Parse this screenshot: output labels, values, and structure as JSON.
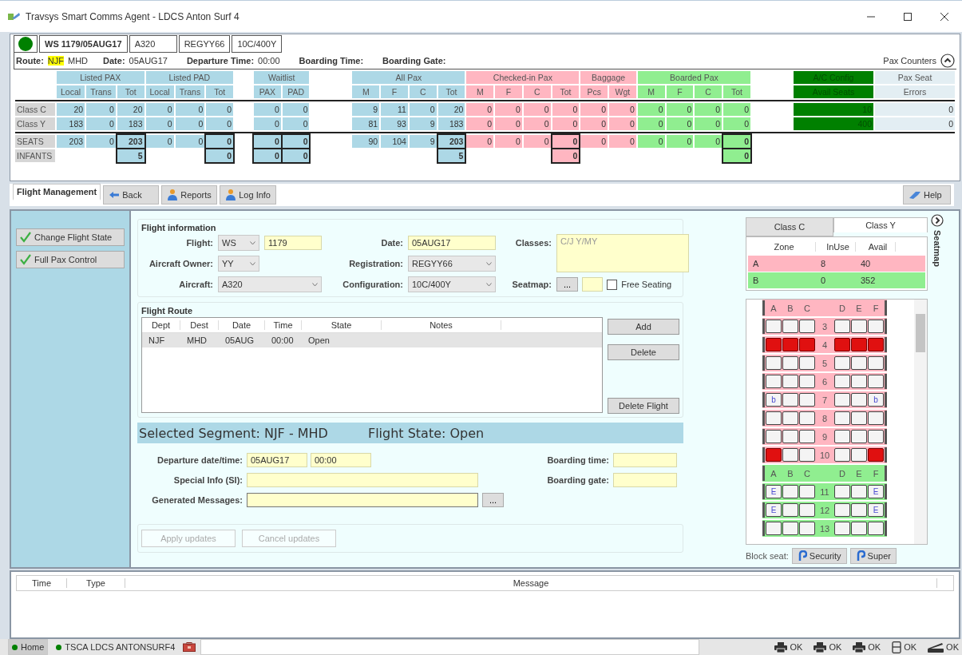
{
  "window": {
    "title": "Travsys Smart Comms Agent - LDCS Anton Surf 4"
  },
  "flight_header": {
    "connected": true,
    "flight": "WS 1179/05AUG17",
    "aircraft": "A320",
    "registration": "REGYY66",
    "configuration": "10C/400Y"
  },
  "route_line": {
    "route_label": "Route:",
    "origin": "NJF",
    "origin_highlighted": true,
    "destination": "MHD",
    "items": [
      {
        "label": "Date:",
        "value": "05AUG17"
      },
      {
        "label": "Departure Time:",
        "value": "00:00"
      },
      {
        "label": "Boarding Time:"
      },
      {
        "label": "Boarding Gate:"
      }
    ]
  },
  "pax_counters": {
    "title": "Pax Counters",
    "expanded": true,
    "groups": [
      {
        "label": "Listed PAX",
        "kind": "blue",
        "columns": [
          {
            "label": "Local",
            "total": false
          },
          {
            "label": "Trans",
            "total": false
          },
          {
            "label": "Tot",
            "total": true
          }
        ]
      },
      {
        "label": "Listed PAD",
        "kind": "blue",
        "columns": [
          {
            "label": "Local",
            "total": false
          },
          {
            "label": "Trans",
            "total": false
          },
          {
            "label": "Tot",
            "total": true
          }
        ]
      },
      {
        "label": "Waitlist",
        "kind": "blue",
        "columns": [
          {
            "label": "PAX",
            "total": true
          },
          {
            "label": "PAD",
            "total": true
          }
        ]
      },
      {
        "label": "All Pax",
        "kind": "blue",
        "columns": [
          {
            "label": "M",
            "total": false
          },
          {
            "label": "F",
            "total": false
          },
          {
            "label": "C",
            "total": false
          },
          {
            "label": "Tot",
            "total": true
          }
        ]
      },
      {
        "label": "Checked-in Pax",
        "kind": "pink",
        "columns": [
          {
            "label": "M",
            "total": false
          },
          {
            "label": "F",
            "total": false
          },
          {
            "label": "C",
            "total": false
          },
          {
            "label": "Tot",
            "total": true
          }
        ]
      },
      {
        "label": "Baggage",
        "kind": "pink",
        "columns": [
          {
            "label": "Pcs",
            "total": false
          },
          {
            "label": "Wgt",
            "total": false
          }
        ]
      },
      {
        "label": "Boarded Pax",
        "kind": "green",
        "columns": [
          {
            "label": "M",
            "total": false
          },
          {
            "label": "F",
            "total": false
          },
          {
            "label": "C",
            "total": false
          },
          {
            "label": "Tot",
            "total": true
          }
        ]
      },
      {
        "label": "A/C Config",
        "kind": "darkgreen",
        "columns": [
          {
            "label": "Avail Seats"
          }
        ]
      },
      {
        "label": "Pax Seat",
        "kind": "light",
        "columns": [
          {
            "label": "Errors"
          }
        ]
      }
    ],
    "rows": [
      {
        "label": "Class C",
        "summary": false,
        "totals_only": false,
        "values": [
          "20",
          "0",
          "20",
          "0",
          "0",
          "0",
          "0",
          "0",
          "9",
          "11",
          "0",
          "20",
          "0",
          "0",
          "0",
          "0",
          "0",
          "0",
          "0",
          "0",
          "0",
          "0",
          "10",
          "0"
        ]
      },
      {
        "label": "Class Y",
        "summary": false,
        "totals_only": false,
        "values": [
          "183",
          "0",
          "183",
          "0",
          "0",
          "0",
          "0",
          "0",
          "81",
          "93",
          "9",
          "183",
          "0",
          "0",
          "0",
          "0",
          "0",
          "0",
          "0",
          "0",
          "0",
          "0",
          "400",
          "0"
        ]
      },
      {
        "label": "SEATS",
        "summary": true,
        "totals_only": false,
        "values": [
          "203",
          "0",
          "203",
          "0",
          "0",
          "0",
          "0",
          "0",
          "90",
          "104",
          "9",
          "203",
          "0",
          "0",
          "0",
          "0",
          "0",
          "0",
          "0",
          "0",
          "0",
          "0"
        ]
      },
      {
        "label": "INFANTS",
        "summary": true,
        "totals_only": true,
        "values": [
          "5",
          "0",
          "0",
          "0",
          "5",
          "0",
          "0"
        ]
      }
    ]
  },
  "toolbar": {
    "tabs": [
      {
        "label": "Flight Management",
        "selected": true
      }
    ],
    "buttons": [
      {
        "kind": "back",
        "label": "Back"
      },
      {
        "kind": "person",
        "label": "Reports"
      },
      {
        "kind": "person",
        "label": "Log Info"
      }
    ],
    "help": "Help"
  },
  "side_actions": [
    {
      "label": "Change Flight State",
      "checked": true
    },
    {
      "label": "Full Pax Control",
      "checked": true
    }
  ],
  "flight_information": {
    "title": "Flight information",
    "flight_label": "Flight:",
    "airline": "WS",
    "flight_number": "1179",
    "date_label": "Date:",
    "date": "05AUG17",
    "classes_label": "Classes:",
    "classes": "C/J Y/MY",
    "classes_disabled": true,
    "owner_label": "Aircraft Owner:",
    "owner": "YY",
    "registration_label": "Registration:",
    "registration": "REGYY66",
    "aircraft_label": "Aircraft:",
    "aircraft": "A320",
    "configuration_label": "Configuration:",
    "configuration": "10C/400Y",
    "seatmap_label": "Seatmap:",
    "seatmap_button": "...",
    "free_seating": {
      "label": "Free Seating",
      "checked": false
    }
  },
  "flight_route": {
    "title": "Flight Route",
    "columns": [
      "Dept",
      "Dest",
      "Date",
      "Time",
      "State",
      "Notes"
    ],
    "rows": [
      {
        "cells": [
          "NJF",
          "MHD",
          "05AUG",
          "00:00",
          "Open"
        ],
        "selected": true
      }
    ],
    "buttons": [
      "Add",
      "Delete",
      "Delete Flight"
    ]
  },
  "selected_segment": {
    "segment": "Selected Segment: NJF - MHD",
    "state": "Flight State: Open"
  },
  "segment_fields": {
    "departure_label": "Departure date/time:",
    "departure_date": "05AUG17",
    "departure_time": "00:00",
    "si_label": "Special Info (SI):",
    "messages_label": "Generated Messages:",
    "messages_button": "...",
    "boarding_time_label": "Boarding time:",
    "boarding_gate_label": "Boarding gate:"
  },
  "update_buttons": [
    {
      "label": "Apply updates",
      "disabled": true
    },
    {
      "label": "Cancel updates",
      "disabled": true
    }
  ],
  "seatmap": {
    "side_label": "Seatmap",
    "tabs": [
      {
        "label": "Class C",
        "selected": false
      },
      {
        "label": "Class Y",
        "selected": true
      }
    ],
    "zone_columns": [
      "Zone",
      "InUse",
      "Avail"
    ],
    "zones": [
      {
        "name": "A",
        "in_use": "8",
        "avail": "40",
        "color": "#ffb6c1",
        "letters": [
          "A",
          "B",
          "C",
          "D",
          "E",
          "F"
        ],
        "rows": [
          {
            "number": "3",
            "seats": [
              {
                "kind": "free"
              },
              {
                "kind": "free"
              },
              {
                "kind": "free"
              },
              {
                "kind": "free"
              },
              {
                "kind": "free"
              },
              {
                "kind": "free"
              }
            ]
          },
          {
            "number": "4",
            "seats": [
              {
                "kind": "blocked"
              },
              {
                "kind": "blocked"
              },
              {
                "kind": "blocked"
              },
              {
                "kind": "blocked"
              },
              {
                "kind": "blocked"
              },
              {
                "kind": "blocked"
              }
            ]
          },
          {
            "number": "5",
            "seats": [
              {
                "kind": "free"
              },
              {
                "kind": "free"
              },
              {
                "kind": "free"
              },
              {
                "kind": "free"
              },
              {
                "kind": "free"
              },
              {
                "kind": "free"
              }
            ]
          },
          {
            "number": "6",
            "seats": [
              {
                "kind": "free"
              },
              {
                "kind": "free"
              },
              {
                "kind": "free"
              },
              {
                "kind": "free"
              },
              {
                "kind": "free"
              },
              {
                "kind": "free"
              }
            ]
          },
          {
            "number": "7",
            "seats": [
              {
                "kind": "free",
                "mark": "b"
              },
              {
                "kind": "free"
              },
              {
                "kind": "free"
              },
              {
                "kind": "free"
              },
              {
                "kind": "free"
              },
              {
                "kind": "free",
                "mark": "b"
              }
            ]
          },
          {
            "number": "8",
            "seats": [
              {
                "kind": "free"
              },
              {
                "kind": "free"
              },
              {
                "kind": "free"
              },
              {
                "kind": "free"
              },
              {
                "kind": "free"
              },
              {
                "kind": "free"
              }
            ]
          },
          {
            "number": "9",
            "seats": [
              {
                "kind": "free"
              },
              {
                "kind": "free"
              },
              {
                "kind": "free"
              },
              {
                "kind": "free"
              },
              {
                "kind": "free"
              },
              {
                "kind": "free"
              }
            ]
          },
          {
            "number": "10",
            "seats": [
              {
                "kind": "blocked"
              },
              {
                "kind": "free"
              },
              {
                "kind": "free"
              },
              {
                "kind": "free"
              },
              {
                "kind": "free"
              },
              {
                "kind": "blocked"
              }
            ]
          }
        ]
      },
      {
        "name": "B",
        "in_use": "0",
        "avail": "352",
        "color": "#90ee90",
        "letters": [
          "A",
          "B",
          "C",
          "D",
          "E",
          "F"
        ],
        "rows": [
          {
            "number": "11",
            "seats": [
              {
                "kind": "free",
                "mark": "E"
              },
              {
                "kind": "free"
              },
              {
                "kind": "free"
              },
              {
                "kind": "free"
              },
              {
                "kind": "free"
              },
              {
                "kind": "free",
                "mark": "E"
              }
            ]
          },
          {
            "number": "12",
            "seats": [
              {
                "kind": "free",
                "mark": "E"
              },
              {
                "kind": "free"
              },
              {
                "kind": "free"
              },
              {
                "kind": "free"
              },
              {
                "kind": "free"
              },
              {
                "kind": "free",
                "mark": "E"
              }
            ]
          },
          {
            "number": "13",
            "seats": [
              {
                "kind": "free"
              },
              {
                "kind": "free"
              },
              {
                "kind": "free"
              },
              {
                "kind": "free"
              },
              {
                "kind": "free"
              },
              {
                "kind": "free"
              }
            ]
          }
        ]
      }
    ],
    "block_label": "Block seat:",
    "block_buttons": [
      "Security",
      "Super"
    ]
  },
  "messages": {
    "columns": [
      "Time",
      "Type",
      "Message"
    ]
  },
  "status_bar": {
    "sessions": [
      {
        "label": "Home",
        "connected": true,
        "selected": true
      },
      {
        "label": "TSCA LDCS ANTONSURF4",
        "connected": true,
        "selected": false
      }
    ],
    "devices": [
      {
        "kind": "printer",
        "status": "OK"
      },
      {
        "kind": "printer",
        "status": "OK"
      },
      {
        "kind": "printer",
        "status": "OK"
      },
      {
        "kind": "reader",
        "status": "OK"
      },
      {
        "kind": "scanner",
        "status": "OK"
      }
    ]
  }
}
